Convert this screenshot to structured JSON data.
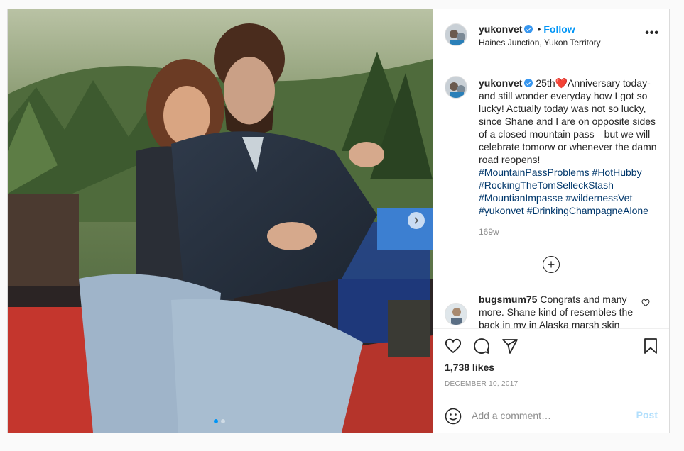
{
  "post": {
    "username": "yukonvet",
    "follow_label": "Follow",
    "bullet": "•",
    "location": "Haines Junction, Yukon Territory",
    "more_label": "•••",
    "caption": {
      "username": "yukonvet",
      "text": " 25th❤️Anniversary today-and still wonder everyday how I got so lucky! Actually today was not so lucky, since Shane and I are on opposite sides of a closed mountain pass—but we will celebrate tomorw or whenever the damn road reopens!",
      "hashtags": [
        "#MountainPassProblems",
        "#HotHubby",
        "#RockingTheTomSelleckStash",
        "#MountianImpasse",
        "#wildernessVet",
        "#yukonvet",
        "#DrinkingChampagneAlone"
      ]
    },
    "time_ago": "169w",
    "load_more_label": "+",
    "comment": {
      "username": "bugsmum75",
      "text": " Congrats and many more. Shane kind of resembles the back in my in Alaska marsh skin"
    },
    "likes": "1,738 likes",
    "date": "DECEMBER 10, 2017",
    "comment_placeholder": "Add a comment…",
    "post_label": "Post",
    "carousel": {
      "count": 2,
      "active": 0
    }
  },
  "colors": {
    "accent": "#0095f6",
    "post_disabled": "#b2dffc",
    "hashtag": "#00376b",
    "muted": "#8e8e8e"
  },
  "icons": [
    "heart-icon",
    "comment-icon",
    "share-icon",
    "bookmark-icon",
    "emoji-icon",
    "chevron-right-icon",
    "verified-icon",
    "plus-circle-icon"
  ]
}
